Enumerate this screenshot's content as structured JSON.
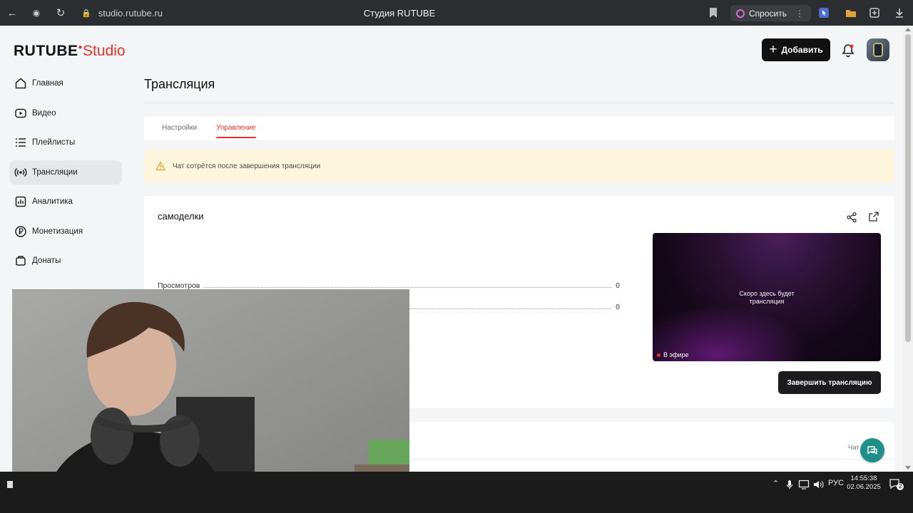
{
  "browser": {
    "url": "studio.rutube.ru",
    "tab_title": "Студия RUTUBE",
    "ask_label": "Спросить"
  },
  "header": {
    "logo_brand": "RUTUBE",
    "logo_studio": "Studio",
    "add_label": "Добавить"
  },
  "sidebar": {
    "items": [
      {
        "label": "Главная",
        "icon": "home-icon"
      },
      {
        "label": "Видео",
        "icon": "video-icon"
      },
      {
        "label": "Плейлисты",
        "icon": "playlist-icon"
      },
      {
        "label": "Трансляции",
        "icon": "broadcast-icon",
        "active": true
      },
      {
        "label": "Аналитика",
        "icon": "analytics-icon"
      },
      {
        "label": "Монетизация",
        "icon": "monetization-icon"
      },
      {
        "label": "Донаты",
        "icon": "donate-icon"
      }
    ]
  },
  "page": {
    "title": "Трансляция",
    "tabs": [
      {
        "label": "Настройки",
        "active": false
      },
      {
        "label": "Управление",
        "active": true
      }
    ],
    "warning": "Чат сотрётся после завершения трансляции"
  },
  "stream": {
    "name": "самоделки",
    "stats": [
      {
        "label": "Просмотров",
        "value": "0"
      },
      {
        "label": "",
        "value": "0"
      }
    ],
    "preview_text_line1": "Скоро здесь будет",
    "preview_text_line2": "трансляция",
    "live_label": "В эфире",
    "end_button": "Завершить трансляцию"
  },
  "chat": {
    "label": "Чат"
  },
  "taskbar": {
    "lang": "РУС",
    "time": "14:55:38",
    "date": "02.06.2025",
    "notifications": "2"
  },
  "colors": {
    "accent": "#e4312b",
    "warning_bg": "#fdf6dc",
    "dark_button": "#1c1c1e",
    "help_button": "#1f8f8a"
  }
}
